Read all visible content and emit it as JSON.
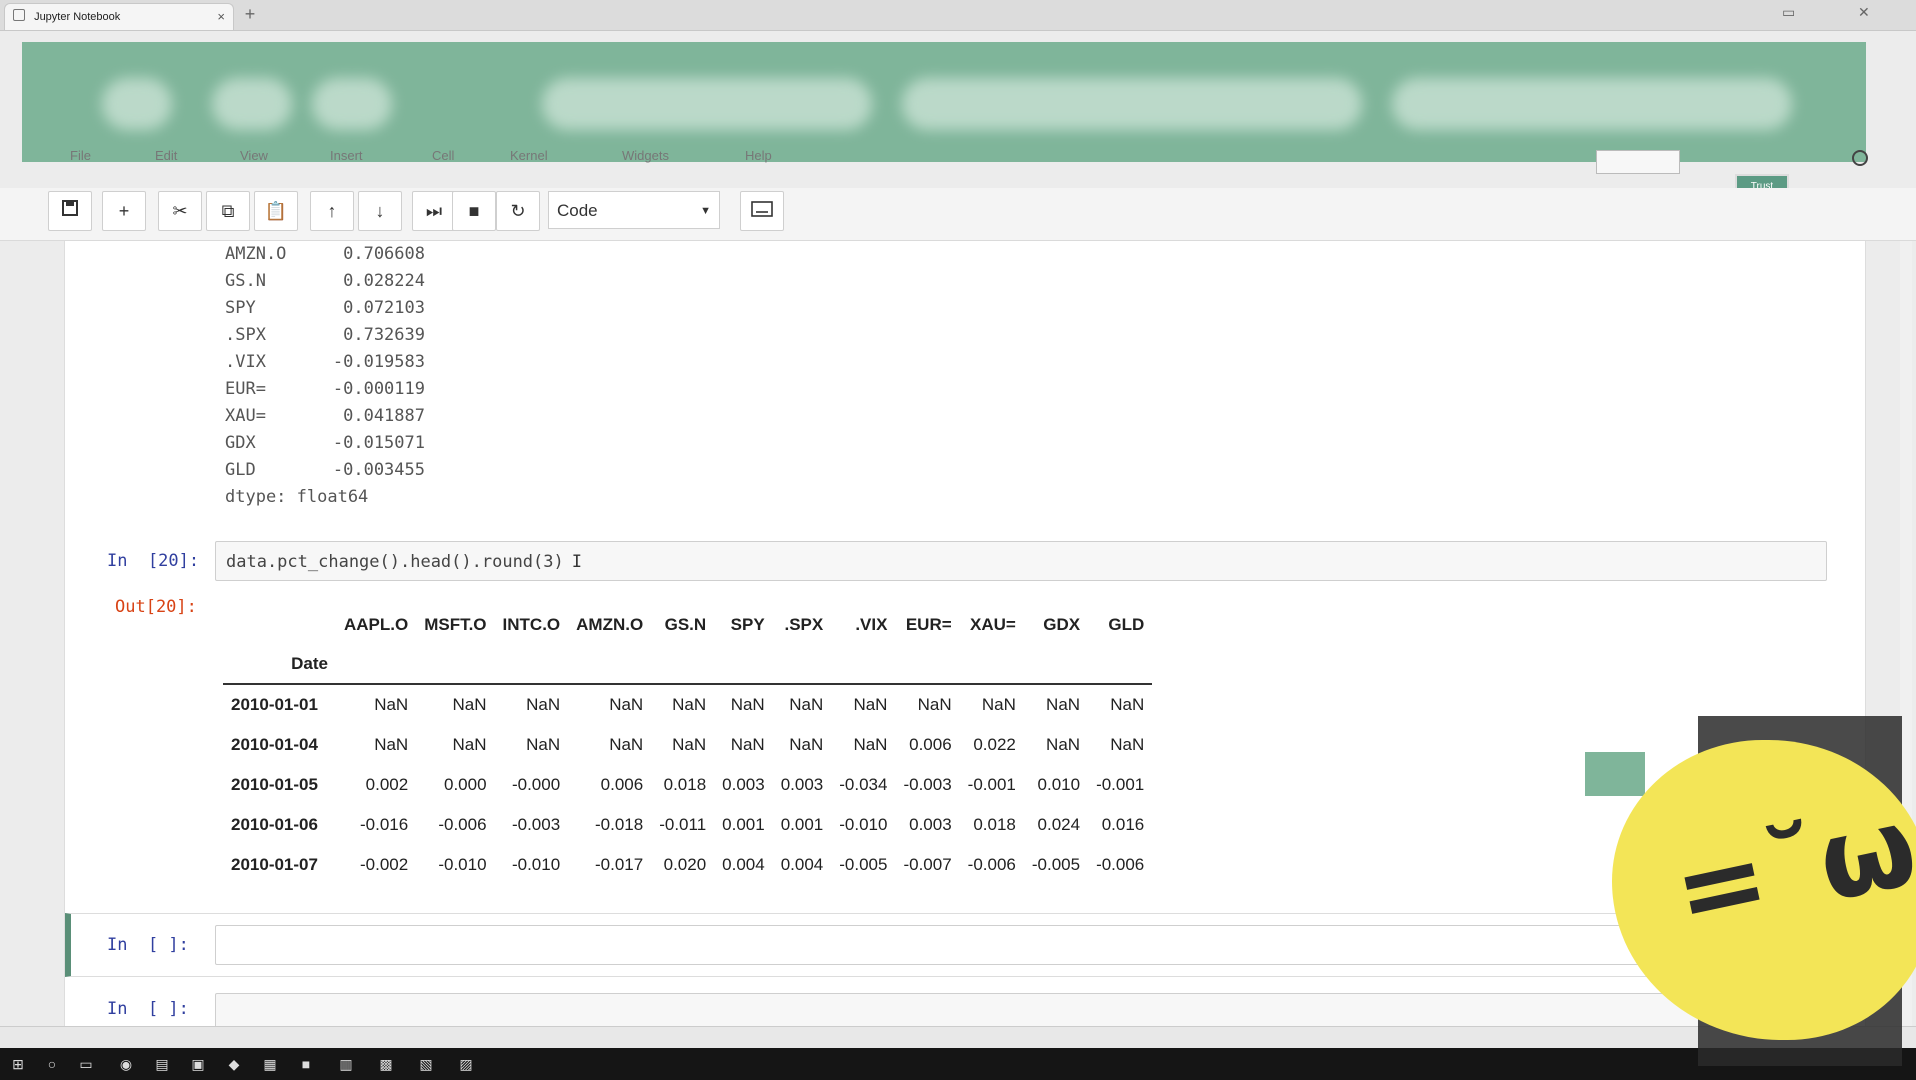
{
  "browser": {
    "tab_title": "Jupyter Notebook",
    "new_tab": "+",
    "close": "×"
  },
  "menu": [
    "File",
    "Edit",
    "View",
    "Insert",
    "Cell",
    "Kernel",
    "Widgets",
    "Help"
  ],
  "header": {
    "logout_label": "Trust"
  },
  "toolbar": {
    "save_icon": "floppy-icon",
    "celltype_value": "Code",
    "buttons": [
      "+",
      "✂",
      "⧉",
      "📋",
      "↑",
      "↓",
      "⏭",
      "■",
      "↻"
    ]
  },
  "output_series": {
    "rows": [
      {
        "label": "AMZN.O",
        "value": "0.706608"
      },
      {
        "label": "GS.N",
        "value": "0.028224"
      },
      {
        "label": "SPY",
        "value": "0.072103"
      },
      {
        "label": ".SPX",
        "value": "0.732639"
      },
      {
        "label": ".VIX",
        "value": "-0.019583"
      },
      {
        "label": "EUR=",
        "value": "-0.000119"
      },
      {
        "label": "XAU=",
        "value": "0.041887"
      },
      {
        "label": "GDX",
        "value": "-0.015071"
      },
      {
        "label": "GLD",
        "value": "-0.003455"
      }
    ],
    "dtype": "dtype: float64"
  },
  "cell20": {
    "in_prompt": "In  [20]:",
    "code": "data.pct_change().head().round(3)",
    "out_prompt": "Out[20]:"
  },
  "dataframe": {
    "index_name": "Date",
    "columns": [
      "AAPL.O",
      "MSFT.O",
      "INTC.O",
      "AMZN.O",
      "GS.N",
      "SPY",
      ".SPX",
      ".VIX",
      "EUR=",
      "XAU=",
      "GDX",
      "GLD"
    ],
    "rows": [
      {
        "index": "2010-01-01",
        "values": [
          "NaN",
          "NaN",
          "NaN",
          "NaN",
          "NaN",
          "NaN",
          "NaN",
          "NaN",
          "NaN",
          "NaN",
          "NaN",
          "NaN"
        ]
      },
      {
        "index": "2010-01-04",
        "values": [
          "NaN",
          "NaN",
          "NaN",
          "NaN",
          "NaN",
          "NaN",
          "NaN",
          "NaN",
          "0.006",
          "0.022",
          "NaN",
          "NaN"
        ]
      },
      {
        "index": "2010-01-05",
        "values": [
          "0.002",
          "0.000",
          "-0.000",
          "0.006",
          "0.018",
          "0.003",
          "0.003",
          "-0.034",
          "-0.003",
          "-0.001",
          "0.010",
          "-0.001"
        ]
      },
      {
        "index": "2010-01-06",
        "values": [
          "-0.016",
          "-0.006",
          "-0.003",
          "-0.018",
          "-0.011",
          "0.001",
          "0.001",
          "-0.010",
          "0.003",
          "0.018",
          "0.024",
          "0.016"
        ]
      },
      {
        "index": "2010-01-07",
        "values": [
          "-0.002",
          "-0.010",
          "-0.010",
          "-0.017",
          "0.020",
          "0.004",
          "0.004",
          "-0.005",
          "-0.007",
          "-0.006",
          "-0.005",
          "-0.006"
        ]
      }
    ]
  },
  "empty_cells": [
    {
      "prompt": "In  [ ]:"
    },
    {
      "prompt": "In  [ ]:"
    }
  ],
  "sticker_text": "=˘ω˘="
}
